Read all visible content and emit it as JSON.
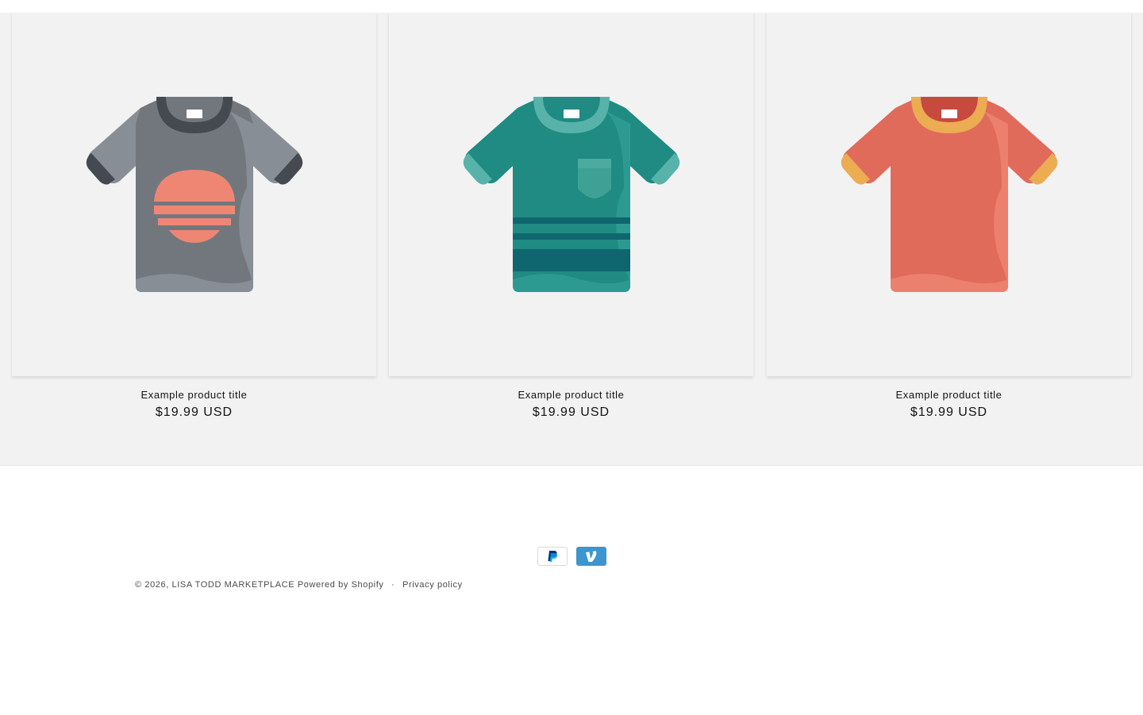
{
  "products": [
    {
      "title": "Example product title",
      "price": "$19.99 USD",
      "image_icon": "gray-sunset-tshirt-icon"
    },
    {
      "title": "Example product title",
      "price": "$19.99 USD",
      "image_icon": "teal-striped-tshirt-icon"
    },
    {
      "title": "Example product title",
      "price": "$19.99 USD",
      "image_icon": "coral-ringer-tshirt-icon"
    }
  ],
  "footer": {
    "copyright": "© 2026,",
    "store_name": "LISA TODD MARKETPLACE",
    "powered_by": "Powered by Shopify",
    "separator": "·",
    "privacy_policy": "Privacy policy",
    "payment_icons": [
      "paypal-icon",
      "venmo-icon"
    ]
  },
  "colors": {
    "section_bg": "#f2f2f2",
    "text": "#121212",
    "venmo_blue": "#3d95ce",
    "paypal_blue": "#003087"
  }
}
